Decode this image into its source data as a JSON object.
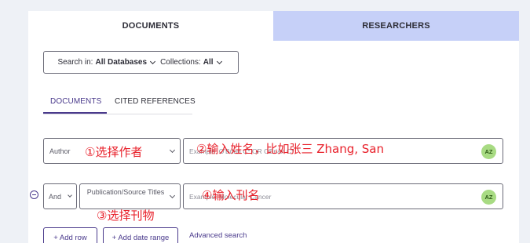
{
  "tabs": {
    "documents": "DOCUMENTS",
    "researchers": "RESEARCHERS"
  },
  "search_in": {
    "label": "Search in:",
    "database": "All Databases",
    "collections_label": "Collections:",
    "collections_value": "All"
  },
  "subtabs": {
    "documents": "DOCUMENTS",
    "cited_references": "CITED REFERENCES"
  },
  "row1": {
    "field": "Author",
    "placeholder": "Example: O'Brian C* OR OBrian C*"
  },
  "row2": {
    "operator": "And",
    "field": "Publication/Source Titles",
    "placeholder": "Example: Molecular Cancer"
  },
  "az_label": "AZ",
  "buttons": {
    "add_row": "+ Add row",
    "add_date_range": "+ Add date range",
    "advanced_search": "Advanced search"
  },
  "annotations": {
    "a1": "①选择作者",
    "a2": "②输入姓名，比如张三 Zhang, San",
    "a3": "④输入刊名",
    "a4": "③选择刊物"
  },
  "colors": {
    "accent": "#4a3a8c",
    "researchers_tab": "#c6d0f8",
    "annotation": "#e8202a",
    "az_badge": "#a8db83"
  }
}
